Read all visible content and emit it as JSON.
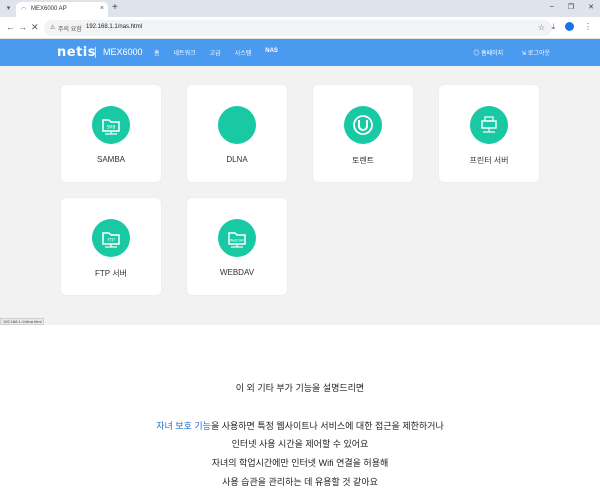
{
  "browser": {
    "tab_title": "MEX6000 AP",
    "url_security_label": "주의 요함",
    "url": "192.168.1.1/nas.html",
    "status_url": "192.168.1.1/dlna.html"
  },
  "router": {
    "logo": "netis",
    "model": "MEX6000",
    "nav_items": [
      "홈",
      "네트워크",
      "고급",
      "시스템",
      "NAS"
    ],
    "active_nav": "NAS",
    "homepage_label": "홈페이지",
    "logout_label": "로그아웃"
  },
  "cards": [
    {
      "label": "SAMBA",
      "icon": "samba-folder-icon",
      "badge": "SMB"
    },
    {
      "label": "DLNA",
      "icon": "dlna-icon",
      "badge": ""
    },
    {
      "label": "토렌트",
      "icon": "torrent-icon",
      "badge": ""
    },
    {
      "label": "프린터 서버",
      "icon": "printer-icon",
      "badge": ""
    },
    {
      "label": "FTP 서버",
      "icon": "ftp-folder-icon",
      "badge": "FTP"
    },
    {
      "label": "WEBDAV",
      "icon": "webdav-folder-icon",
      "badge": "WebDAV"
    }
  ],
  "article": {
    "line1": "이 외 기타 부가 기능을 설명드리면",
    "highlight": "자녀 보호 기능",
    "line2_rest": "을 사용하면 특정 웹사이트나 서비스에 대한 접근을 제한하거나",
    "line3": "인터넷 사용 시간을 제어할 수 있어요",
    "line4": "자녀의 학업시간에만 인터넷 Wifi 연결을 허용해",
    "line5": "사용 습관을 관리하는 데 유용할 것 같아요"
  },
  "colors": {
    "header_blue": "#4a9bf0",
    "icon_teal": "#18c9a3",
    "highlight_blue": "#1f6ec9"
  }
}
